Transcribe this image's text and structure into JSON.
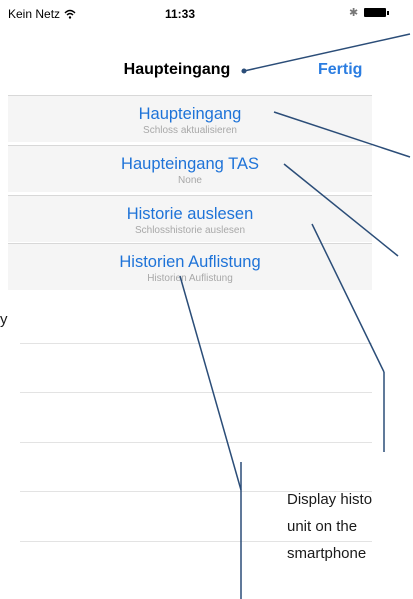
{
  "status_bar": {
    "carrier": "Kein Netz",
    "time": "11:33"
  },
  "nav": {
    "title": "Haupteingang",
    "done_label": "Fertig"
  },
  "menu_items": [
    {
      "title": "Haupteingang",
      "subtitle": "Schloss aktualisieren"
    },
    {
      "title": "Haupteingang TAS",
      "subtitle": "None"
    },
    {
      "title": "Historie auslesen",
      "subtitle": "Schlosshistorie auslesen"
    },
    {
      "title": "Historien Auflistung",
      "subtitle": "Historien Auflistung"
    }
  ],
  "annotation": {
    "lines": [
      "Display histo",
      "unit on the",
      "smartphone"
    ],
    "left_fragment": "y"
  },
  "colors": {
    "accent": "#1e73d8",
    "callout_line": "#2b4d78"
  }
}
